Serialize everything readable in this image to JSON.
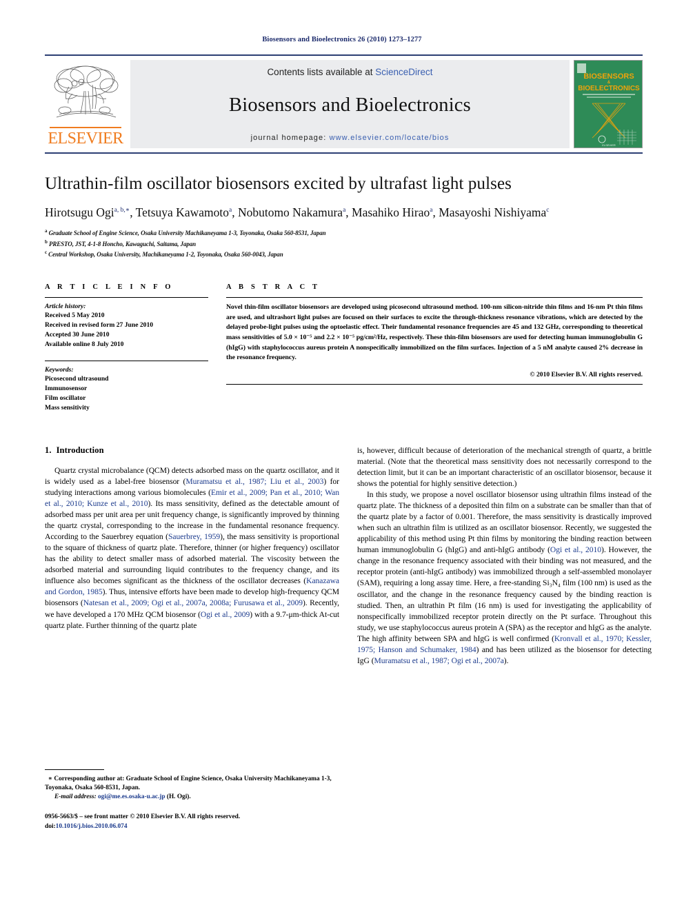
{
  "running_head": "Biosensors and Bioelectronics 26 (2010) 1273–1277",
  "header": {
    "contents_prefix": "Contents lists available at ",
    "sciencedirect": "ScienceDirect",
    "journal_name": "Biosensors and Bioelectronics",
    "homepage_prefix": "journal homepage:",
    "homepage_url": "www.elsevier.com/locate/bios",
    "publisher_wordmark": "ELSEVIER",
    "cover": {
      "line1": "BIOSENSORS",
      "amp": "&",
      "line2": "BIOELECTRONICS",
      "subtitle": "The principal international journal devoted to research, design, development and application of biosensors and bioelectronics",
      "footer": "ELSEVIER"
    },
    "accent_blue": "#3a5fb0",
    "rule_color": "#2c3e73",
    "elsevier_orange": "#F07C1F",
    "cover_green": "#2e8b57"
  },
  "article": {
    "title": "Ultrathin-film oscillator biosensors excited by ultrafast light pulses",
    "authors": [
      {
        "name": "Hirotsugu Ogi",
        "marks": "a, b,∗",
        "sep": ", "
      },
      {
        "name": "Tetsuya Kawamoto",
        "marks": "a",
        "sep": ", "
      },
      {
        "name": "Nobutomo Nakamura",
        "marks": "a",
        "sep": ", "
      },
      {
        "name": "Masahiko Hirao",
        "marks": "a",
        "sep": ","
      },
      {
        "name": "Masayoshi Nishiyama",
        "marks": "c",
        "sep": ""
      }
    ],
    "affiliations": [
      {
        "mark": "a",
        "text": "Graduate School of Engine Science, Osaka University Machikaneyama 1-3, Toyonaka, Osaka 560-8531, Japan"
      },
      {
        "mark": "b",
        "text": "PRESTO, JST, 4-1-8 Honcho, Kawaguchi, Saitama, Japan"
      },
      {
        "mark": "c",
        "text": "Central Workshop, Osaka University, Machikaneyama 1-2, Toyonaka, Osaka 560-0043, Japan"
      }
    ]
  },
  "article_info": {
    "heading": "A R T I C L E   I N F O",
    "history_title": "Article history:",
    "history": [
      "Received 5 May 2010",
      "Received in revised form 27 June 2010",
      "Accepted 30 June 2010",
      "Available online 8 July 2010"
    ],
    "keywords_title": "Keywords:",
    "keywords": [
      "Picosecond ultrasound",
      "Immunosensor",
      "Film oscillator",
      "Mass sensitivity"
    ]
  },
  "abstract": {
    "heading": "A B S T R A C T",
    "text": "Novel thin-film oscillator biosensors are developed using picosecond ultrasound method. 100-nm silicon-nitride thin films and 16-nm Pt thin films are used, and ultrashort light pulses are focused on their surfaces to excite the through-thickness resonance vibrations, which are detected by the delayed probe-light pulses using the optoelastic effect. Their fundamental resonance frequencies are 45 and 132 GHz, corresponding to theoretical mass sensitivities of 5.0 × 10⁻⁵ and 2.2 × 10⁻⁵ pg/cm²/Hz, respectively. These thin-film biosensors are used for detecting human immunoglobulin G (hIgG) with staphylococcus aureus protein A nonspecifically immobilized on the film surfaces. Injection of a 5 nM analyte caused 2% decrease in the resonance frequency.",
    "copyright": "© 2010 Elsevier B.V. All rights reserved."
  },
  "sections": {
    "intro_number": "1.",
    "intro_title": "Introduction"
  },
  "body": {
    "left": [
      "Quartz crystal microbalance (QCM) detects adsorbed mass on the quartz oscillator, and it is widely used as a label-free biosensor (Muramatsu et al., 1987; Liu et al., 2003) for studying interactions among various biomolecules (Emir et al., 2009; Pan et al., 2010; Wan et al., 2010; Kunze et al., 2010). Its mass sensitivity, defined as the detectable amount of adsorbed mass per unit area per unit frequency change, is significantly improved by thinning the quartz crystal, corresponding to the increase in the fundamental resonance frequency. According to the Sauerbrey equation (Sauerbrey, 1959), the mass sensitivity is proportional to the square of thickness of quartz plate. Therefore, thinner (or higher frequency) oscillator has the ability to detect smaller mass of adsorbed material. The viscosity between the adsorbed material and surrounding liquid contributes to the frequency change, and its influence also becomes significant as the thickness of the oscillator decreases (Kanazawa and Gordon, 1985). Thus, intensive efforts have been made to develop high-frequency QCM biosensors (Natesan et al., 2009; Ogi et al., 2007a, 2008a; Furusawa et al., 2009). Recently, we have developed a 170 MHz QCM biosensor (Ogi et al., 2009) with a 9.7-μm-thick At-cut quartz plate. Further thinning of the quartz plate"
    ],
    "right": [
      "is, however, difficult because of deterioration of the mechanical strength of quartz, a brittle material. (Note that the theoretical mass sensitivity does not necessarily correspond to the detection limit, but it can be an important characteristic of an oscillator biosensor, because it shows the potential for highly sensitive detection.)",
      "In this study, we propose a novel oscillator biosensor using ultrathin films instead of the quartz plate. The thickness of a deposited thin film on a substrate can be smaller than that of the quartz plate by a factor of 0.001. Therefore, the mass sensitivity is drastically improved when such an ultrathin film is utilized as an oscillator biosensor. Recently, we suggested the applicability of this method using Pt thin films by monitoring the binding reaction between human immunoglobulin G (hIgG) and anti-hIgG antibody (Ogi et al., 2010). However, the change in the resonance frequency associated with their binding was not measured, and the receptor protein (anti-hIgG antibody) was immobilized through a self-assembled monolayer (SAM), requiring a long assay time. Here, a free-standing Si₃N₄ film (100 nm) is used as the oscillator, and the change in the resonance frequency caused by the binding reaction is studied. Then, an ultrathin Pt film (16 nm) is used for investigating the applicability of nonspecifically immobilized receptor protein directly on the Pt surface. Throughout this study, we use staphylococcus aureus protein A (SPA) as the receptor and hIgG as the analyte. The high affinity between SPA and hIgG is well confirmed (Kronvall et al., 1970; Kessler, 1975; Hanson and Schumaker, 1984) and has been utilized as the biosensor for detecting IgG (Muramatsu et al., 1987; Ogi et al., 2007a)."
    ]
  },
  "footnote": {
    "star": "∗",
    "corresponding": "Corresponding author at: Graduate School of Engine Science, Osaka University Machikaneyama 1-3, Toyonaka, Osaka 560-8531, Japan.",
    "email_label": "E-mail address:",
    "email": "ogi@me.es.osaka-u.ac.jp",
    "email_suffix": "(H. Ogi)."
  },
  "imprint": {
    "issn_line": "0956-5663/$ – see front matter © 2010 Elsevier B.V. All rights reserved.",
    "doi_label": "doi:",
    "doi": "10.1016/j.bios.2010.06.074"
  }
}
